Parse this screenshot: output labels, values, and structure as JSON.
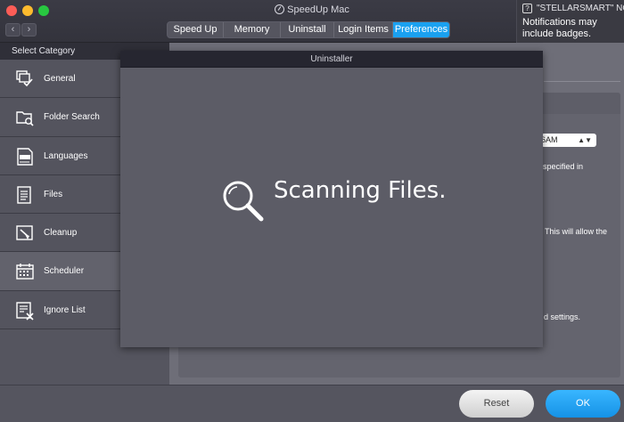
{
  "window": {
    "title": "SpeedUp Mac"
  },
  "tabs": [
    "Speed Up",
    "Memory",
    "Uninstall",
    "Login Items",
    "Preferences"
  ],
  "active_tab": "Preferences",
  "notification": {
    "title": "\"STELLARSMART\" NOTI",
    "body": "Notifications may include badges."
  },
  "sidebar": {
    "header": "Select Category",
    "items": [
      {
        "label": "General",
        "icon": "general-icon"
      },
      {
        "label": "Folder Search",
        "icon": "folder-search-icon"
      },
      {
        "label": "Languages",
        "icon": "languages-icon"
      },
      {
        "label": "Files",
        "icon": "files-icon"
      },
      {
        "label": "Cleanup",
        "icon": "cleanup-icon"
      },
      {
        "label": "Scheduler",
        "icon": "scheduler-icon"
      },
      {
        "label": "Ignore List",
        "icon": "ignore-list-icon"
      }
    ],
    "active": "Scheduler"
  },
  "background_fragments": {
    "time_value": "6AM",
    "text1": "specified in",
    "text2": "This will allow the",
    "text3": "d settings."
  },
  "modal": {
    "title": "Uninstaller",
    "status": "Scanning Files."
  },
  "footer": {
    "reset_label": "Reset",
    "ok_label": "OK"
  },
  "colors": {
    "accent": "#1aa1f0",
    "ok_button": "#1e9cf0"
  }
}
